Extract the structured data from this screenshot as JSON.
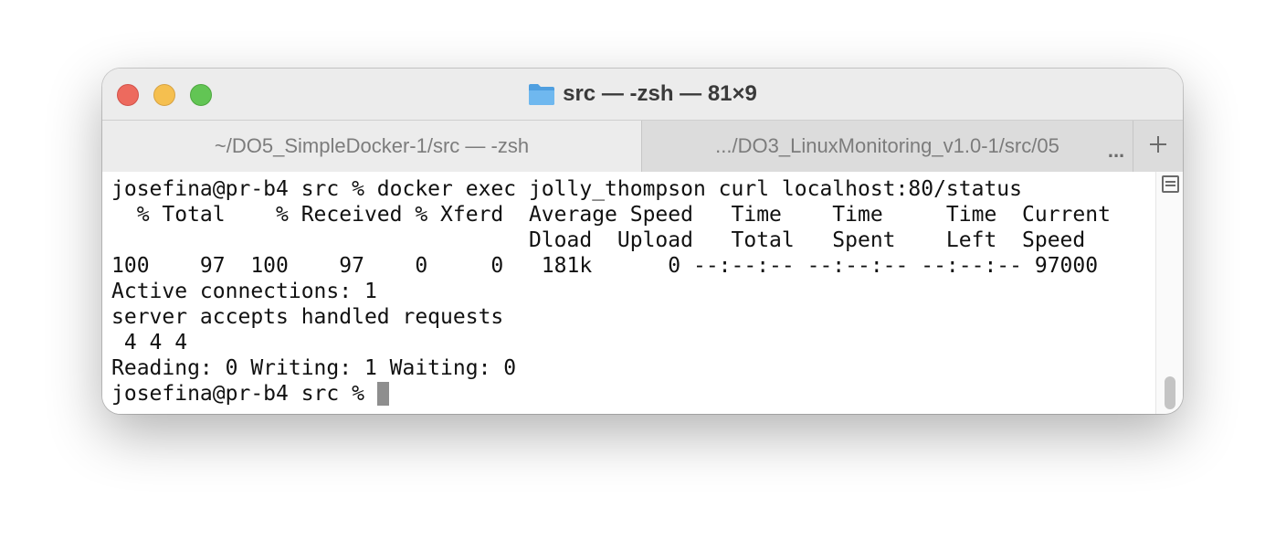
{
  "window": {
    "title": "src — -zsh — 81×9"
  },
  "tabs": [
    {
      "label": "~/DO5_SimpleDocker-1/src — -zsh"
    },
    {
      "label": ".../DO3_LinuxMonitoring_v1.0-1/src/05"
    }
  ],
  "tab_overflow_label": "...",
  "new_tab_label": "+",
  "colors": {
    "close": "#ed6a5e",
    "minimize": "#f5bf4f",
    "maximize": "#62c554",
    "folder": "#5aa9e6"
  },
  "icons": {
    "title": "folder-icon",
    "new_tab": "plus-icon",
    "split": "split-view-icon"
  },
  "terminal": {
    "lines": [
      "josefina@pr-b4 src % docker exec jolly_thompson curl localhost:80/status",
      "  % Total    % Received % Xferd  Average Speed   Time    Time     Time  Current",
      "                                 Dload  Upload   Total   Spent    Left  Speed",
      "100    97  100    97    0     0   181k      0 --:--:-- --:--:-- --:--:-- 97000",
      "Active connections: 1",
      "server accepts handled requests",
      " 4 4 4",
      "Reading: 0 Writing: 1 Waiting: 0"
    ],
    "prompt": "josefina@pr-b4 src % "
  }
}
